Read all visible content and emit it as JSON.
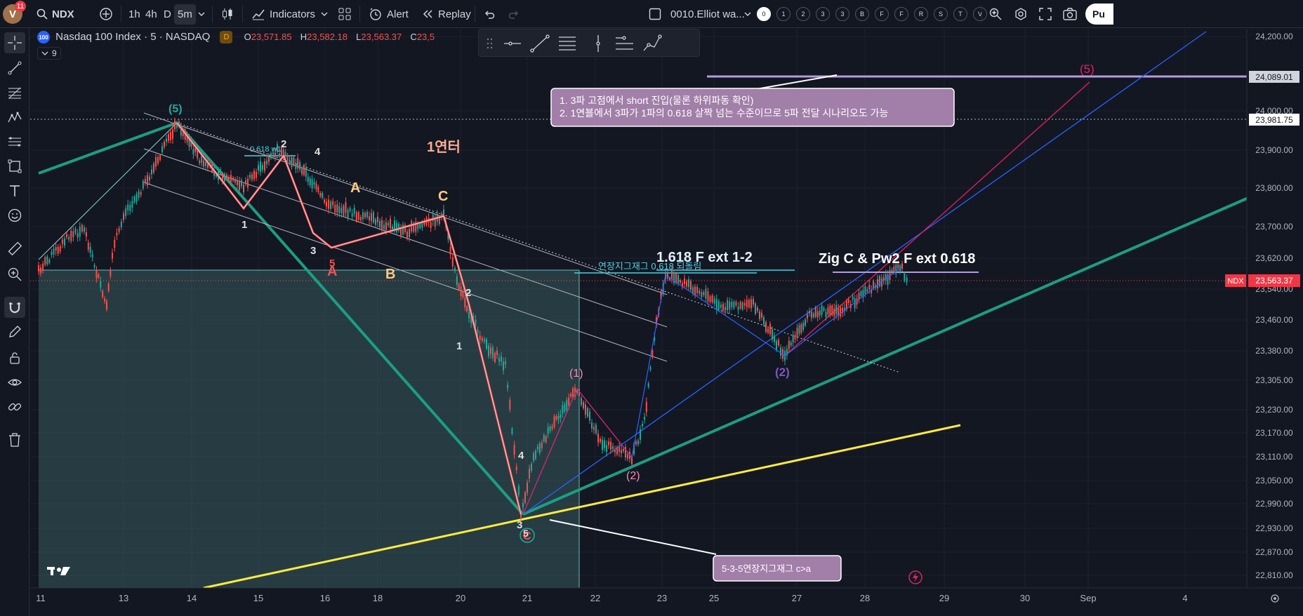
{
  "topbar": {
    "avatar_letter": "V",
    "notif_count": "11",
    "symbol": "NDX",
    "intervals": [
      "1h",
      "4h",
      "D",
      "5m"
    ],
    "indicators_label": "Indicators",
    "alert_label": "Alert",
    "replay_label": "Replay",
    "layout_name": "0010.Elliot wa...",
    "hotkeys": [
      "0",
      "1",
      "2",
      "3",
      "3",
      "B",
      "F",
      "F",
      "R",
      "S",
      "T",
      "V"
    ],
    "publish_label": "Pu"
  },
  "legend": {
    "badge": "100",
    "title": "Nasdaq 100 Index · 5 · NASDAQ",
    "d_badge": "D",
    "o_label": "O",
    "o_value": "23,571.85",
    "h_label": "H",
    "h_value": "23,582.18",
    "l_label": "L",
    "l_value": "23,563.37",
    "c_label": "C",
    "c_value": "23,5",
    "indicator_count": "9"
  },
  "price_axis": {
    "ticks": [
      "24,200.00",
      "24,000.00",
      "23,900.00",
      "23,800.00",
      "23,700.00",
      "23,620.00",
      "23,540.00",
      "23,460.00",
      "23,380.00",
      "23,305.00",
      "23,230.00",
      "23,170.00",
      "23,110.00",
      "23,050.00",
      "22,990.00",
      "22,930.00",
      "22,870.00",
      "22,810.00"
    ],
    "tag_24089": "24,089.01",
    "tag_23981": "23,981.75",
    "ndx_tag_symbol": "NDX",
    "ndx_tag_price": "23,563.37"
  },
  "time_axis": {
    "ticks": [
      "11",
      "13",
      "14",
      "15",
      "16",
      "18",
      "20",
      "21",
      "22",
      "23",
      "25",
      "27",
      "28",
      "29",
      "30",
      "Sep",
      "4"
    ]
  },
  "annotations": {
    "note1_line1": "1. 3파 고점에서  short 진입(물론 하위파동 확인)",
    "note1_line2": "2. 1연뵬에서 3파가 1파의 0.618 살짝 넘는 수준이므로 5파 전달 시나리오도 가능",
    "note2": "5-3-5연장지그재그  c>a",
    "yeonteo": "1연터",
    "fib_ext": "1.618 F ext 1-2",
    "zig_c": "Zig C & Pw2 F ext 0.618",
    "retrace_label": "연장지그재그 0.618 되돌림",
    "w1_label": "0.618 w1",
    "wave_5_top": "(5)",
    "wave_5_right": "(5)",
    "wave_1_paren": "(1)",
    "wave_2_paren": "(2)",
    "wave_2_purple": "(2)",
    "wave_C_circle": "C",
    "wave_5_low": "5",
    "lbl_A_big": "A",
    "lbl_A_red": "A",
    "lbl_B": "B",
    "lbl_C": "C",
    "w_1a": "1",
    "w_2a": "2",
    "w_3a": "3",
    "w_4a": "4",
    "w_5a": "5",
    "w_1b": "1",
    "w_2b": "2",
    "w_3b": "3",
    "w_4b": "4"
  },
  "colors": {
    "bg": "#131722",
    "up": "#26a69a",
    "down": "#ef5350",
    "accent": "#2962ff",
    "yellow": "#ffeb3b",
    "purple": "#b39ddb",
    "teal": "#1b9e85"
  }
}
